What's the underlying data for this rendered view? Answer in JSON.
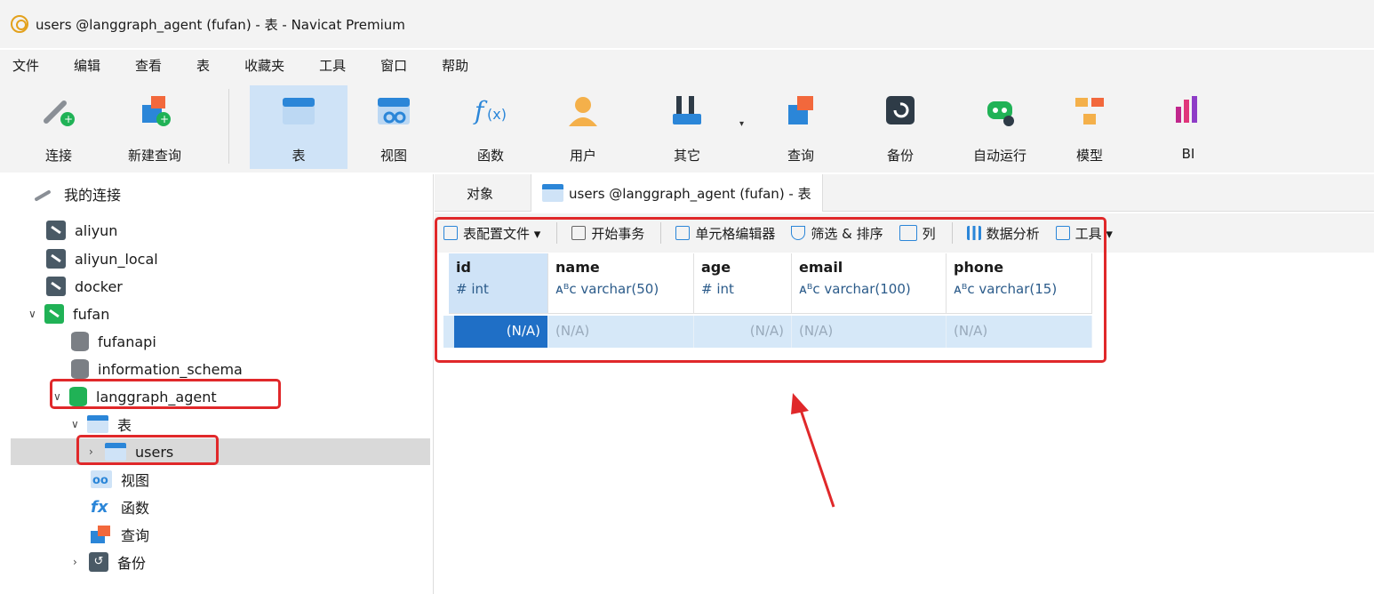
{
  "window": {
    "title": "users @langgraph_agent (fufan) - 表 - Navicat Premium"
  },
  "menu": [
    "文件",
    "编辑",
    "查看",
    "表",
    "收藏夹",
    "工具",
    "窗口",
    "帮助"
  ],
  "toolbar": {
    "connect": "连接",
    "new_query": "新建查询",
    "table": "表",
    "view": "视图",
    "function": "函数",
    "user": "用户",
    "other": "其它",
    "query": "查询",
    "backup": "备份",
    "automation": "自动运行",
    "model": "模型",
    "bi": "BI"
  },
  "tree": {
    "root": "我的连接",
    "connections": [
      "aliyun",
      "aliyun_local",
      "docker",
      "fufan"
    ],
    "databases": [
      "fufanapi",
      "information_schema",
      "langgraph_agent"
    ],
    "table_group": "表",
    "table": "users",
    "view": "视图",
    "function": "函数",
    "query": "查询",
    "backup": "备份"
  },
  "tabs": {
    "objects": "对象",
    "active": "users @langgraph_agent (fufan) - 表"
  },
  "subtoolbar": {
    "profile": "表配置文件 ▾",
    "begin_tx": "开始事务",
    "cell_editor": "单元格编辑器",
    "filter_sort": "筛选 & 排序",
    "columns": "列",
    "analysis": "数据分析",
    "tools": "工具 ▾"
  },
  "grid": {
    "columns": [
      {
        "name": "id",
        "type": "# int"
      },
      {
        "name": "name",
        "type": "ᴀᴮc varchar(50)"
      },
      {
        "name": "age",
        "type": "# int"
      },
      {
        "name": "email",
        "type": "ᴀᴮc varchar(100)"
      },
      {
        "name": "phone",
        "type": "ᴀᴮc varchar(15)"
      }
    ],
    "row": [
      "(N/A)",
      "(N/A)",
      "(N/A)",
      "(N/A)",
      "(N/A)"
    ]
  },
  "colors": {
    "accent": "#2b86d8",
    "highlight": "#e0282a",
    "selected": "#1f6fc6"
  }
}
